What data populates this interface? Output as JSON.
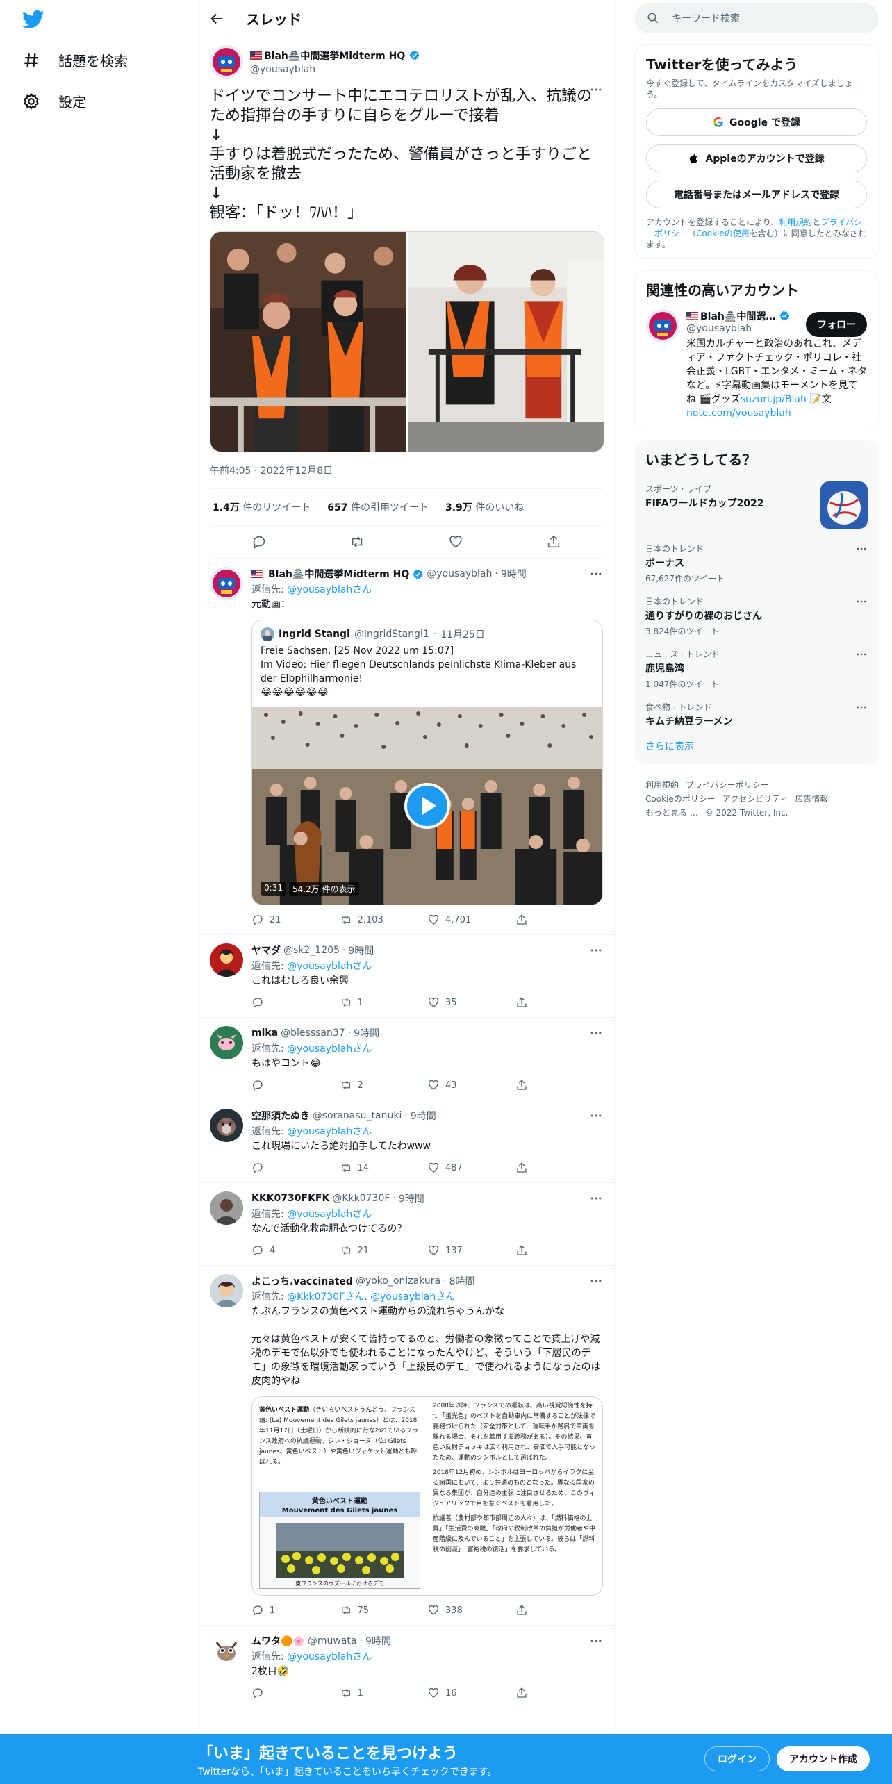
{
  "colors": {
    "accent": "#1d9bf0",
    "text": "#0f1419",
    "muted": "#536471",
    "border": "#eff3f4"
  },
  "nav": {
    "logo_icon": "twitter-bird-icon",
    "items": [
      {
        "label": "話題を検索",
        "icon": "hashtag-icon"
      },
      {
        "label": "設定",
        "icon": "gear-icon"
      }
    ]
  },
  "header": {
    "title": "スレッド"
  },
  "main_tweet": {
    "name": "Blah🏯中間選挙Midterm HQ",
    "handle": "@yousayblah",
    "text": "ドイツでコンサート中にエコテロリストが乱入、抗議のため指揮台の手すりに自らをグルーで接着\n↓\n手すりは着脱式だったため、警備員がさっと手すりごと活動家を撤去\n↓\n観客：「ドッ！ﾜﾊﾊ！」",
    "timestamp": "午前4:05 · 2022年12月8日",
    "retweets": "1.4万",
    "retweets_label": "件のリツイート",
    "quotes": "657",
    "quotes_label": "件の引用ツイート",
    "likes": "3.9万",
    "likes_label": "件のいいね"
  },
  "replies": [
    {
      "name": "Blah🏯中間選挙Midterm HQ",
      "handle": "@yousayblah",
      "time": "9時間",
      "replyto_prefix": "返信先: ",
      "replyto": "@yousayblahさん",
      "text": "元動画：",
      "quote": {
        "name": "Ingrid Stangl",
        "handle": "@IngridStangl1",
        "time": "11月25日",
        "text": "Freie Sachsen, [25 Nov 2022 um 15:07]\nIm Video: Hier fliegen Deutschlands peinlichste Klima-Kleber aus der Elbphilharmonie!\n😂😂😂😂😂😂",
        "duration": "0:31",
        "views": "54.2万 件の表示"
      },
      "counts": {
        "reply": "21",
        "retweet": "2,103",
        "like": "4,701"
      }
    },
    {
      "name": "ヤマダ",
      "handle": "@sk2_1205",
      "time": "9時間",
      "replyto_prefix": "返信先: ",
      "replyto": "@yousayblahさん",
      "text": "これはむしろ良い余興",
      "counts": {
        "reply": "",
        "retweet": "1",
        "like": "35"
      }
    },
    {
      "name": "mika",
      "handle": "@blesssan37",
      "time": "9時間",
      "replyto_prefix": "返信先: ",
      "replyto": "@yousayblahさん",
      "text": "もはやコント😂",
      "counts": {
        "reply": "",
        "retweet": "2",
        "like": "43"
      }
    },
    {
      "name": "空那須たぬき",
      "handle": "@soranasu_tanuki",
      "time": "9時間",
      "replyto_prefix": "返信先: ",
      "replyto": "@yousayblahさん",
      "text": "これ現場にいたら絶対拍手してたわwww",
      "counts": {
        "reply": "",
        "retweet": "14",
        "like": "487"
      }
    },
    {
      "name": "KKK0730FKFK",
      "handle": "@Kkk0730F",
      "time": "9時間",
      "replyto_prefix": "返信先: ",
      "replyto": "@yousayblahさん",
      "text": "なんで活動化救命胴衣つけてるの？",
      "counts": {
        "reply": "4",
        "retweet": "21",
        "like": "137"
      }
    },
    {
      "name": "よこっち.vaccinated",
      "handle": "@yoko_onizakura",
      "time": "8時間",
      "replyto_prefix": "返信先: ",
      "replyto": "@Kkk0730Fさん, @yousayblahさん",
      "text": "たぶんフランスの黄色ベスト運動からの流れちゃうんかな\n\n元々は黄色ベストが安くて皆持ってるのと、労働者の象徴ってことで賃上げや減税のデモで仏以外でも使われることになったんやけど、そういう「下層民のデモ」の象徴を環境活動家っていう「上級民のデモ」で使われるようになったのは皮肉的やね",
      "wiki": {
        "heading": "黄色いベスト運動",
        "paren": "（きいろいベストうんどう、フランス語: (Le) Mouvement des Gilets jaunes）とは、2018年11月17日（土曜日）から断続的に行なわれているフランス政府への抗議運動。ジレ・ジョーヌ（仏: Gilets jaunes、黄色いベスト）や黄色いジャケット運動とも呼ばれる。",
        "box_title": "黄色いベスト運動",
        "box_subtitle": "Mouvement des Gilets jaunes",
        "caption": "東フランスのヴズールにおけるデモ",
        "col2a": "2008年以降、フランスでの運転は、高い視覚認識性を持つ「蛍光色」のベストを自動車内に常備することが法律で義務づけられた（安全対策として、運転手が路肩で車両を離れる場合、それを着用する義務がある）。その結果、黄色い反射チョッキは広く利用され、安価で入手可能となったため、運動のシンボルとして選ばれた。",
        "col2b": "2018年12月初め、シンボルはヨーロッパからイラクに至る諸国において、より共通のものとなった。異なる国家の異なる集団が、自分達の主張に注目させるため、このヴィジュアリックで目を惹くベストを着用した。",
        "col2c": "抗議者（農村部や都市部周辺の人々）は、「燃料価格の上昇」「生活費の高騰」「政府の税制改革の負担が労働者や中産階級に及んでいること」を主張している。彼らは「燃料税の削減」「富裕税の復活」を要求している。"
      },
      "counts": {
        "reply": "1",
        "retweet": "75",
        "like": "338"
      }
    },
    {
      "name": "ムワタ🟠🌸",
      "handle": "@muwata",
      "time": "9時間",
      "replyto_prefix": "返信先: ",
      "replyto": "@yousayblahさん",
      "text": "2枚目🤣",
      "counts": {
        "reply": "",
        "retweet": "1",
        "like": "16"
      }
    }
  ],
  "right": {
    "search_placeholder": "キーワード検索",
    "signup": {
      "title": "Twitterを使ってみよう",
      "subtitle": "今すぐ登録して、タイムラインをカスタマイズしましょう。",
      "google": "Google で登録",
      "apple": "Appleのアカウントで登録",
      "phone": "電話番号またはメールアドレスで登録",
      "legal_1": "アカウントを登録することにより、",
      "legal_link1": "利用規約",
      "legal_2": "と",
      "legal_link2": "プライバシーポリシー",
      "legal_3": "（",
      "legal_link3": "Cookieの使用",
      "legal_4": "を含む）に同意したとみなされます。"
    },
    "related": {
      "title": "関連性の高いアカウント",
      "name": "Blah🏯中間選…",
      "handle": "@yousayblah",
      "follow": "フォロー",
      "bio": "米国カルチャーと政治のあれこれ、メディア・ファクトチェック・ポリコレ・社会正義・LGBT・エンタメ・ミーム・ネタなど。⚡字幕動画集はモーメントを見てね 🎬グッズ",
      "link1": "suzuri.jp/Blah",
      "bio2": " 📝文",
      "link2": "note.com/yousayblah"
    },
    "trends": {
      "title": "いまどうしてる？",
      "items": [
        {
          "category": "スポーツ · ライブ",
          "title": "FIFAワールドカップ2022",
          "count": ""
        },
        {
          "category": "日本のトレンド",
          "title": "ボーナス",
          "count": "67,627件のツイート"
        },
        {
          "category": "日本のトレンド",
          "title": "通りすがりの裸のおじさん",
          "count": "3,824件のツイート"
        },
        {
          "category": "ニュース · トレンド",
          "title": "鹿児島湾",
          "count": "1,047件のツイート"
        },
        {
          "category": "食べ物 · トレンド",
          "title": "キムチ納豆ラーメン",
          "count": ""
        }
      ],
      "show_more": "さらに表示"
    },
    "footer": [
      "利用規約",
      "プライバシーポリシー",
      "Cookieのポリシー",
      "アクセシビリティ",
      "広告情報",
      "もっと見る …",
      "© 2022 Twitter, Inc."
    ]
  },
  "bottom": {
    "headline": "「いま」起きていることを見つけよう",
    "sub": "Twitterなら、「いま」起きていることをいち早くチェックできます。",
    "login": "ログイン",
    "signup": "アカウント作成"
  }
}
